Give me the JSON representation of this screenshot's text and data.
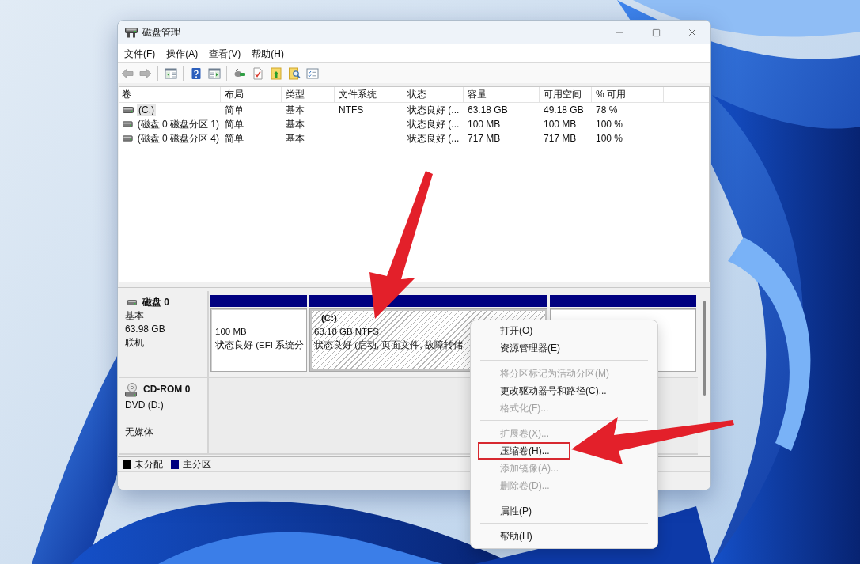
{
  "window": {
    "title": "磁盘管理",
    "controls": [
      {
        "kind": "minimize"
      },
      {
        "kind": "maximize"
      },
      {
        "kind": "close"
      }
    ]
  },
  "menu_bar": [
    "文件(F)",
    "操作(A)",
    "查看(V)",
    "帮助(H)"
  ],
  "toolbar": {
    "groups": [
      [
        {
          "kind": "back",
          "disabled": true
        },
        {
          "kind": "forward",
          "disabled": true
        }
      ],
      [
        {
          "kind": "tree",
          "disabled": false
        }
      ],
      [
        {
          "kind": "help",
          "disabled": false
        },
        {
          "kind": "pane",
          "disabled": false
        }
      ],
      [
        {
          "kind": "connect",
          "disabled": false
        },
        {
          "kind": "checkdoc",
          "disabled": false
        },
        {
          "kind": "folderup",
          "disabled": false
        },
        {
          "kind": "foldersearch",
          "disabled": false
        },
        {
          "kind": "checklist",
          "disabled": false
        }
      ]
    ]
  },
  "volume_table": {
    "columns": [
      "卷",
      "布局",
      "类型",
      "文件系统",
      "状态",
      "容量",
      "可用空间",
      "% 可用"
    ],
    "rows": [
      {
        "selected": true,
        "volume": "(C:)",
        "layout": "简单",
        "type": "基本",
        "file_system": "NTFS",
        "status": "状态良好 (...",
        "capacity": "63.18 GB",
        "free_space": "49.18 GB",
        "percent_free": "78 %"
      },
      {
        "selected": false,
        "volume": "(磁盘 0 磁盘分区 1)",
        "layout": "简单",
        "type": "基本",
        "status": "状态良好 (...",
        "capacity": "100 MB",
        "free_space": "100 MB",
        "percent_free": "100 %"
      },
      {
        "selected": false,
        "volume": "(磁盘 0 磁盘分区 4)",
        "layout": "简单",
        "type": "基本",
        "status": "状态良好 (...",
        "capacity": "717 MB",
        "free_space": "717 MB",
        "percent_free": "100 %"
      }
    ]
  },
  "disks": [
    {
      "kind": "disk",
      "name": "磁盘 0",
      "type": "基本",
      "size": "63.98 GB",
      "status": "联机",
      "partitions": [
        {
          "selected": false,
          "color": "#000080",
          "size": "100 MB",
          "status": "状态良好 (EFI 系统分"
        },
        {
          "selected": true,
          "color": "#000080",
          "label": "(C:)",
          "size": "63.18 GB NTFS",
          "status": "状态良好 (启动, 页面文件, 故障转储,"
        },
        {
          "selected": false,
          "color": "#000080"
        }
      ]
    },
    {
      "kind": "cdrom",
      "name": "CD-ROM 0",
      "type": "DVD (D:)",
      "status": "无媒体"
    }
  ],
  "legend": [
    {
      "label": "未分配",
      "color": "#000000"
    },
    {
      "label": "主分区",
      "color": "#000080"
    }
  ],
  "context_menu": {
    "groups": [
      [
        {
          "label": "打开(O)",
          "disabled": false,
          "highlighted": false
        },
        {
          "label": "资源管理器(E)",
          "disabled": false,
          "highlighted": false
        }
      ],
      [
        {
          "label": "将分区标记为活动分区(M)",
          "disabled": true,
          "highlighted": false
        },
        {
          "label": "更改驱动器号和路径(C)...",
          "disabled": false,
          "highlighted": false
        },
        {
          "label": "格式化(F)...",
          "disabled": true,
          "highlighted": false
        }
      ],
      [
        {
          "label": "扩展卷(X)...",
          "disabled": true,
          "highlighted": false
        },
        {
          "label": "压缩卷(H)...",
          "disabled": false,
          "highlighted": true
        },
        {
          "label": "添加镜像(A)...",
          "disabled": true,
          "highlighted": false
        },
        {
          "label": "删除卷(D)...",
          "disabled": true,
          "highlighted": false
        }
      ],
      [
        {
          "label": "属性(P)",
          "disabled": false,
          "highlighted": false
        }
      ],
      [
        {
          "label": "帮助(H)",
          "disabled": false,
          "highlighted": false
        }
      ]
    ]
  },
  "annotations": [
    {
      "kind": "arrow"
    },
    {
      "kind": "arrow"
    }
  ]
}
